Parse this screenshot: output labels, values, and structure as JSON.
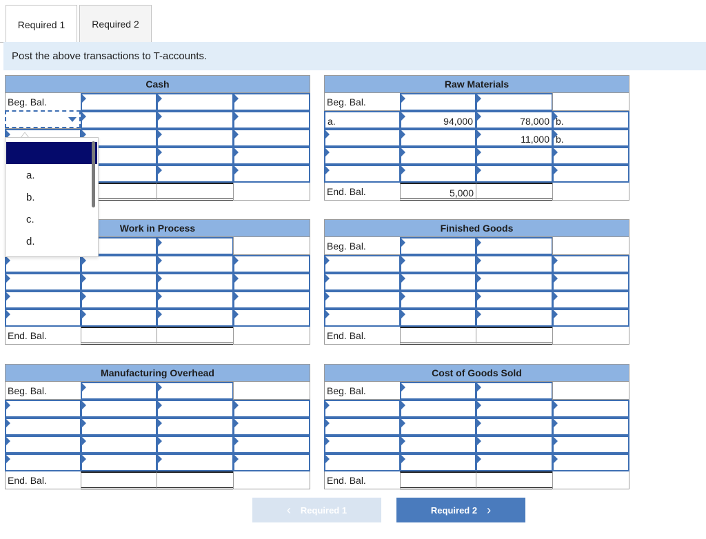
{
  "tabs": [
    {
      "label": "Required 1",
      "active": true
    },
    {
      "label": "Required 2",
      "active": false
    }
  ],
  "instruction": "Post the above transactions to T-accounts.",
  "accounts": {
    "cash": {
      "title": "Cash",
      "beg_label": "Beg. Bal.",
      "end_label": ""
    },
    "raw_materials": {
      "title": "Raw Materials",
      "beg_label": "Beg. Bal.",
      "row1_label": "a.",
      "row1_debit": "94,000",
      "row1_credit": "78,000",
      "row1_post": "b.",
      "row2_credit": "11,000",
      "row2_post": "b.",
      "end_label": "End. Bal.",
      "end_debit": "5,000"
    },
    "work_in_process": {
      "title": "Work in Process",
      "end_label": "End. Bal."
    },
    "finished_goods": {
      "title": "Finished Goods",
      "beg_label": "Beg. Bal.",
      "end_label": "End. Bal."
    },
    "manufacturing_overhead": {
      "title": "Manufacturing Overhead",
      "beg_label": "Beg. Bal.",
      "end_label": "End. Bal."
    },
    "cost_of_goods_sold": {
      "title": "Cost of Goods Sold",
      "beg_label": "Beg. Bal.",
      "end_label": "End. Bal."
    }
  },
  "dropdown": {
    "options": [
      "a.",
      "b.",
      "c.",
      "d."
    ]
  },
  "nav": {
    "prev_label": "Required 1",
    "next_label": "Required 2"
  },
  "colors": {
    "header_blue": "#8db3e2",
    "input_border": "#3e6fb3",
    "next_button": "#4a7bbd",
    "prev_button": "#d9e4f1",
    "dropdown_highlight": "#050a6b",
    "instruction_band": "#e1edf8"
  }
}
